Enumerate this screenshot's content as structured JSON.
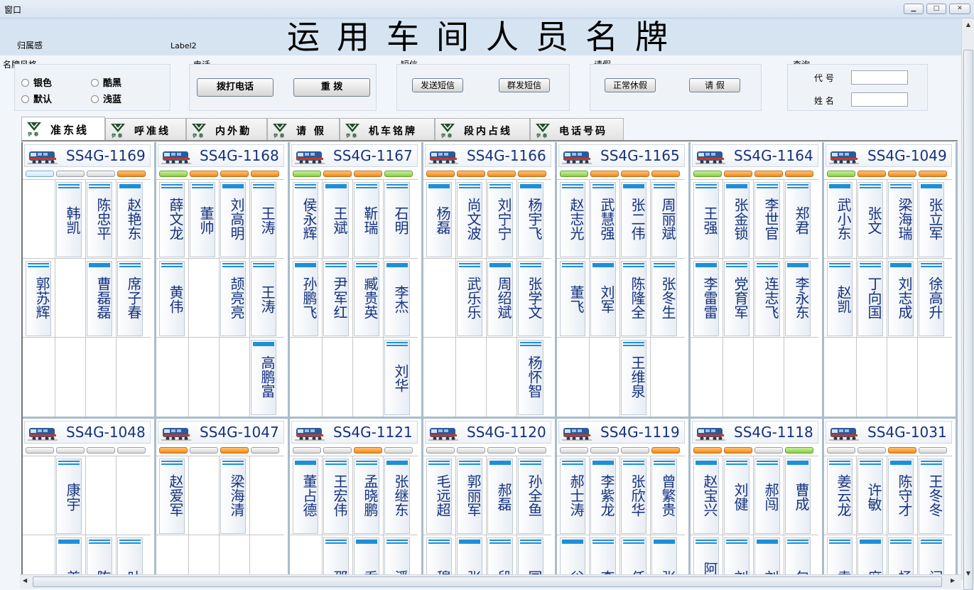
{
  "window": {
    "title": "窗口"
  },
  "header": {
    "title": "运用车间人员名牌",
    "label_left": "归属感",
    "label_mid": "Label2"
  },
  "style_group": {
    "title": "名牌风格",
    "options": [
      "银色",
      "酷黑",
      "默认",
      "浅蓝"
    ]
  },
  "phone_group": {
    "title": "电话",
    "buttons": [
      "拨打电话",
      "重 拨"
    ]
  },
  "sms_group": {
    "title": "短信",
    "buttons": [
      "发送短信",
      "群发短信"
    ]
  },
  "leave_group": {
    "title": "请假",
    "buttons": [
      "正常休假",
      "请 假"
    ]
  },
  "query_group": {
    "title": "查询",
    "fields": [
      {
        "label": "代 号",
        "value": ""
      },
      {
        "label": "姓 名",
        "value": ""
      }
    ]
  },
  "tabs": [
    {
      "label": "准东线",
      "logo": "伊泰"
    },
    {
      "label": "呼准线",
      "logo": "伊泰"
    },
    {
      "label": "内外勤",
      "logo": "伊泰"
    },
    {
      "label": "请 假",
      "logo": "伊泰"
    },
    {
      "label": "机车铭牌",
      "logo": "伊泰"
    },
    {
      "label": "段内占线",
      "logo": "伊泰"
    },
    {
      "label": "电话号码",
      "logo": "伊泰"
    }
  ],
  "active_tab": 0,
  "colors": {
    "lamp_orange": "#f08a10",
    "lamp_green": "#86cf40",
    "lamp_blue": "#cfe6f7",
    "card_bar": "#1e8fd8",
    "name_text": "#16327e"
  },
  "board": {
    "rows": [
      {
        "locos": [
          {
            "id": "SS4G-1169",
            "lamps": [
              "blue",
              "gray",
              "gray",
              "orange"
            ],
            "cards": [
              [
                "",
                "韩凯",
                "陈忠平",
                "赵艳东"
              ],
              [
                "郭苏辉",
                "",
                "曹磊磊",
                "席子春"
              ],
              [
                "",
                "",
                "",
                ""
              ]
            ]
          },
          {
            "id": "SS4G-1168",
            "lamps": [
              "green",
              "orange",
              "orange",
              "orange"
            ],
            "cards": [
              [
                "薛文龙",
                "董帅",
                "刘高明",
                "王涛"
              ],
              [
                "黄伟",
                "",
                "颉亮亮",
                "王涛"
              ],
              [
                "",
                "",
                "",
                "高鹏富"
              ]
            ]
          },
          {
            "id": "SS4G-1167",
            "lamps": [
              "green",
              "orange",
              "orange",
              "green"
            ],
            "cards": [
              [
                "侯永辉",
                "王斌",
                "靳瑞",
                "石明"
              ],
              [
                "孙鹏飞",
                "尹军红",
                "臧贵英",
                "李杰"
              ],
              [
                "",
                "",
                "",
                "刘华"
              ]
            ]
          },
          {
            "id": "SS4G-1166",
            "lamps": [
              "orange",
              "orange",
              "orange",
              "orange"
            ],
            "cards": [
              [
                "杨磊",
                "尚文波",
                "刘宁宁",
                "杨宇飞"
              ],
              [
                "",
                "武乐乐",
                "周绍斌",
                "张学文"
              ],
              [
                "",
                "",
                "",
                "杨怀智"
              ]
            ]
          },
          {
            "id": "SS4G-1165",
            "lamps": [
              "green",
              "orange",
              "orange",
              "orange"
            ],
            "cards": [
              [
                "赵志光",
                "武慧强",
                "张二伟",
                "周丽斌"
              ],
              [
                "董飞",
                "刘军",
                "陈隆全",
                "张冬生"
              ],
              [
                "",
                "",
                "王维泉",
                ""
              ]
            ]
          },
          {
            "id": "SS4G-1164",
            "lamps": [
              "green",
              "orange",
              "orange",
              "orange"
            ],
            "cards": [
              [
                "王强",
                "张金锁",
                "李世官",
                "郑君"
              ],
              [
                "李雷雷",
                "党育军",
                "连志飞",
                "李永东"
              ],
              [
                "",
                "",
                "",
                ""
              ]
            ]
          },
          {
            "id": "SS4G-1049",
            "lamps": [
              "green",
              "orange",
              "orange",
              "orange"
            ],
            "cards": [
              [
                "武小东",
                "张文",
                "梁海瑞",
                "张立军"
              ],
              [
                "赵凯",
                "丁向国",
                "刘志成",
                "徐高升"
              ],
              [
                "",
                "",
                "",
                ""
              ]
            ]
          }
        ]
      },
      {
        "locos": [
          {
            "id": "SS4G-1048",
            "lamps": [
              "gray",
              "gray",
              "gray",
              "gray"
            ],
            "cards": [
              [
                "",
                "康宇",
                "",
                ""
              ],
              [
                "",
                "姜",
                "陈",
                "叶"
              ]
            ]
          },
          {
            "id": "SS4G-1047",
            "lamps": [
              "orange",
              "gray",
              "orange",
              "gray"
            ],
            "cards": [
              [
                "赵爱军",
                "",
                "梁海清",
                ""
              ],
              [
                "",
                "",
                "",
                ""
              ]
            ]
          },
          {
            "id": "SS4G-1121",
            "lamps": [
              "gray",
              "gray",
              "orange",
              "gray"
            ],
            "cards": [
              [
                "董占德",
                "王宏伟",
                "孟晓鹏",
                "张继东"
              ],
              [
                "",
                "邵",
                "乔",
                "潘"
              ]
            ]
          },
          {
            "id": "SS4G-1120",
            "lamps": [
              "gray",
              "gray",
              "gray",
              "gray"
            ],
            "cards": [
              [
                "毛远超",
                "郭丽军",
                "郝磊",
                "孙全鱼"
              ],
              [
                "穆",
                "张",
                "段",
                "国"
              ]
            ]
          },
          {
            "id": "SS4G-1119",
            "lamps": [
              "gray",
              "gray",
              "gray",
              "orange"
            ],
            "cards": [
              [
                "郝士涛",
                "李紫龙",
                "张欣华",
                "曾繁贵"
              ],
              [
                "谷",
                "李",
                "任",
                "张"
              ]
            ]
          },
          {
            "id": "SS4G-1118",
            "lamps": [
              "orange",
              "orange",
              "gray",
              "green"
            ],
            "cards": [
              [
                "赵宝兴",
                "刘健",
                "郝闯",
                "曹成"
              ],
              [
                "阿荣",
                "刘",
                "刘",
                "包"
              ]
            ]
          },
          {
            "id": "SS4G-1031",
            "lamps": [
              "gray",
              "gray",
              "orange",
              "gray"
            ],
            "cards": [
              [
                "姜云龙",
                "许敏",
                "陈守才",
                "王冬冬"
              ],
              [
                "袁",
                "席",
                "杨",
                "闫"
              ]
            ]
          }
        ]
      }
    ]
  }
}
